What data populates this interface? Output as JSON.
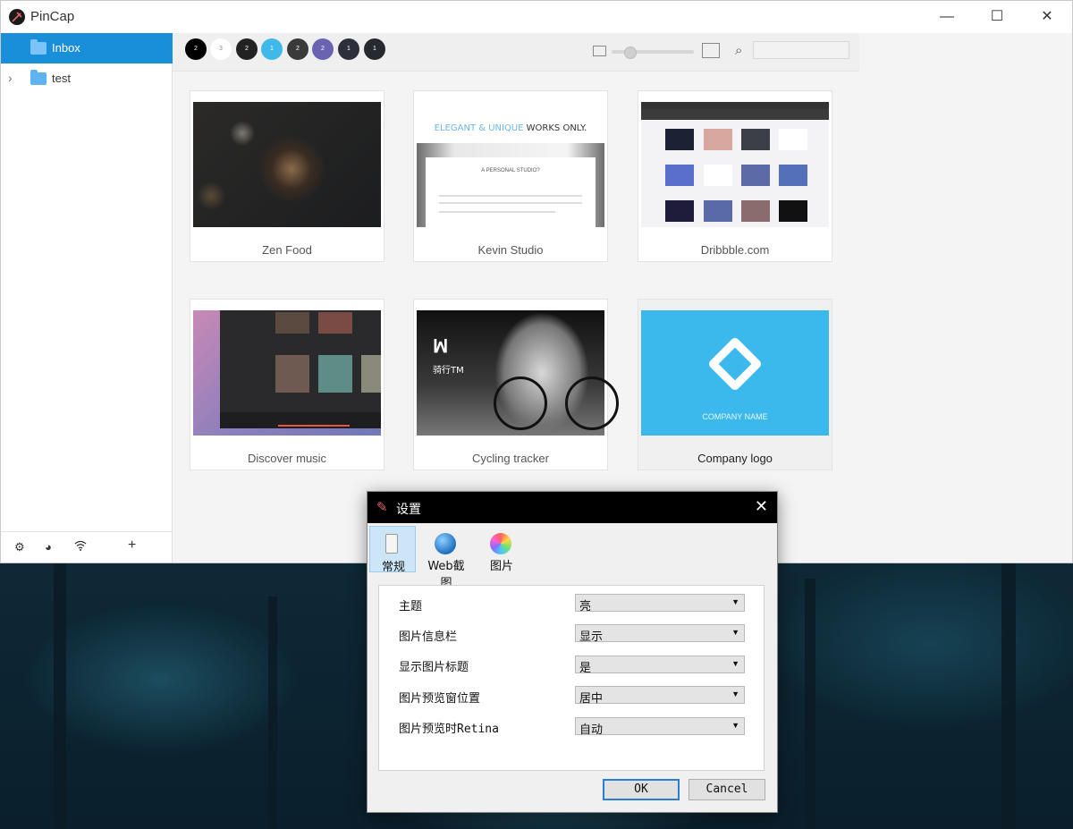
{
  "app": {
    "title": "PinCap"
  },
  "window_controls": {
    "minimize": "—",
    "maximize": "☐",
    "close": "✕"
  },
  "sidebar": {
    "items": [
      {
        "label": "Inbox",
        "active": true
      },
      {
        "label": "test",
        "expandable": true
      }
    ],
    "bottom_icons": [
      "gear-icon",
      "globe-icon",
      "wifi-icon",
      "plus-icon"
    ]
  },
  "toolbar": {
    "color_dots": [
      {
        "color": "#000000",
        "label": "2"
      },
      {
        "color": "#ffffff",
        "label": "3"
      },
      {
        "color": "#222222",
        "label": "2"
      },
      {
        "color": "#3fb8ea",
        "label": "1"
      },
      {
        "color": "#3a3a3a",
        "label": "2"
      },
      {
        "color": "#6a63b2",
        "label": "2"
      },
      {
        "color": "#2d2f3a",
        "label": "1"
      },
      {
        "color": "#262a30",
        "label": "1"
      }
    ],
    "zoom_level": 0.15,
    "search_placeholder": ""
  },
  "cards": [
    {
      "caption": "Zen Food"
    },
    {
      "caption": "Kevin Studio"
    },
    {
      "caption": "Dribbble.com"
    },
    {
      "caption": "Discover music"
    },
    {
      "caption": "Cycling tracker"
    },
    {
      "caption": "Company logo",
      "selected": true
    }
  ],
  "thumb_text": {
    "kevin_headline_a": "ELEGANT & UNIQUE",
    "kevin_headline_b": " WORKS ONLY.",
    "kevin_sub": "A PERSONAL STUDIO?",
    "cycling_brand": "骑行TM",
    "company_name": "COMPANY NAME"
  },
  "dialog": {
    "title": "设置",
    "tabs": [
      {
        "label": "常规",
        "icon": "phone-icon",
        "active": true
      },
      {
        "label": "Web截图",
        "icon": "globe-icon"
      },
      {
        "label": "图片",
        "icon": "color-wheel-icon"
      }
    ],
    "settings": [
      {
        "label": "主题",
        "value": "亮"
      },
      {
        "label": "图片信息栏",
        "value": "显示"
      },
      {
        "label": "显示图片标题",
        "value": "是"
      },
      {
        "label": "图片预览窗位置",
        "value": "居中"
      },
      {
        "label": "图片预览时Retina",
        "value": "自动"
      }
    ],
    "ok": "OK",
    "cancel": "Cancel"
  }
}
